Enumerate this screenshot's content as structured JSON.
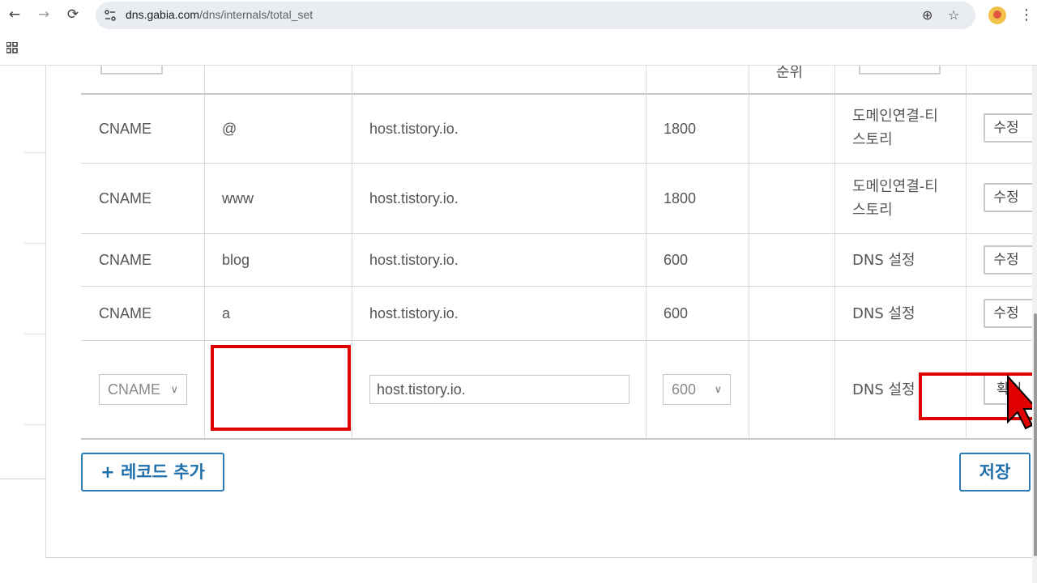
{
  "browser": {
    "url_domain": "dns.gabia.com",
    "url_path": "/dns/internals/total_set"
  },
  "header_partial": {
    "priority_label": "순위"
  },
  "records": [
    {
      "type": "CNAME",
      "host": "@",
      "value": "host.tistory.io.",
      "ttl": "1800",
      "service_line1": "도메인연결-티",
      "service_line2": "스토리",
      "action": "수정"
    },
    {
      "type": "CNAME",
      "host": "www",
      "value": "host.tistory.io.",
      "ttl": "1800",
      "service_line1": "도메인연결-티",
      "service_line2": "스토리",
      "action": "수정"
    },
    {
      "type": "CNAME",
      "host": "blog",
      "value": "host.tistory.io.",
      "ttl": "600",
      "service_line1": "DNS 설정",
      "service_line2": "",
      "action": "수정"
    },
    {
      "type": "CNAME",
      "host": "a",
      "value": "host.tistory.io.",
      "ttl": "600",
      "service_line1": "DNS 설정",
      "service_line2": "",
      "action": "수정"
    }
  ],
  "new_record": {
    "type": "CNAME",
    "host": "",
    "value": "host.tistory.io.",
    "ttl": "600",
    "service": "DNS 설정",
    "confirm": "확인"
  },
  "actions": {
    "add_record": "+ 레코드 추가",
    "save": "저장"
  },
  "colors": {
    "highlight": "#e00000",
    "primary_button": "#1f6fab"
  }
}
